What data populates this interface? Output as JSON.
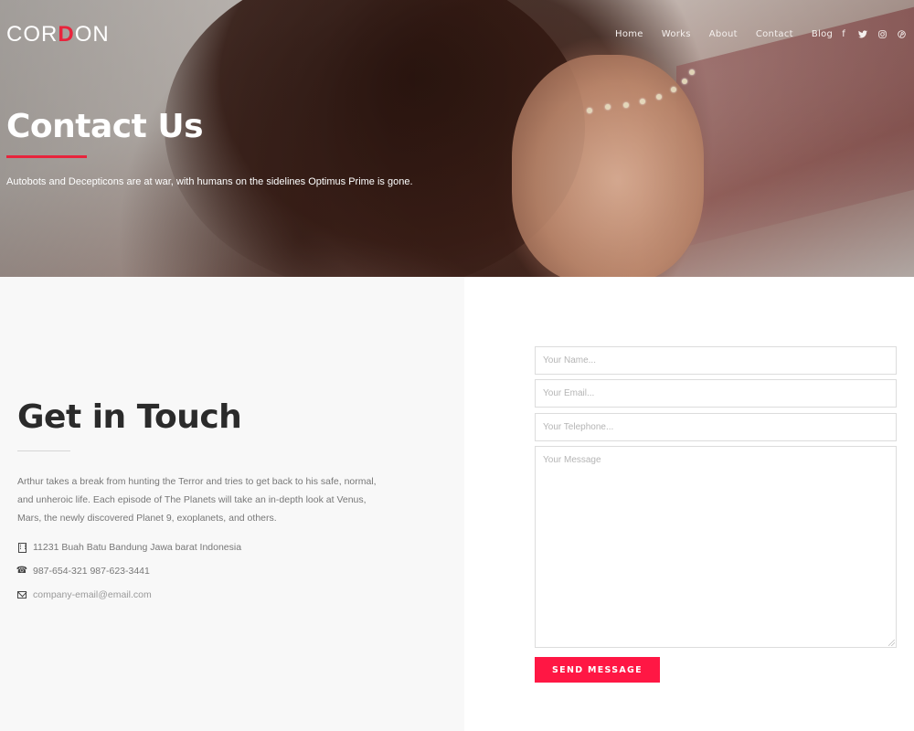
{
  "brand": {
    "logo_text_a": "COR",
    "logo_text_mark": "D",
    "logo_text_b": "ON",
    "accent_color": "#e8243c",
    "button_color": "#ff1744"
  },
  "nav": {
    "items": [
      {
        "label": "Home"
      },
      {
        "label": "Works"
      },
      {
        "label": "About"
      },
      {
        "label": "Contact"
      },
      {
        "label": "Blog"
      }
    ]
  },
  "social": {
    "icons": [
      {
        "name": "facebook-icon",
        "glyph": "f"
      },
      {
        "name": "twitter-icon",
        "glyph": "🐦"
      },
      {
        "name": "instagram-icon",
        "glyph": "◎"
      },
      {
        "name": "pinterest-icon",
        "glyph": "℗"
      }
    ]
  },
  "hero": {
    "title": "Contact Us",
    "subtitle": "Autobots and Decepticons are at war, with humans on the sidelines Optimus Prime is gone."
  },
  "contact": {
    "title": "Get in Touch",
    "description": "Arthur takes a break from hunting the Terror and tries to get back to his safe, normal, and unheroic life. Each episode of The Planets will take an in-depth look at Venus, Mars, the newly discovered Planet 9, exoplanets, and others.",
    "address": "11231 Buah Batu Bandung Jawa barat Indonesia",
    "phone": "987-654-321 987-623-3441",
    "email": "company-email@email.com"
  },
  "form": {
    "name_placeholder": "Your Name...",
    "email_placeholder": "Your Email...",
    "telephone_placeholder": "Your Telephone...",
    "message_placeholder": "Your Message",
    "submit_label": "SEND MESSAGE"
  }
}
